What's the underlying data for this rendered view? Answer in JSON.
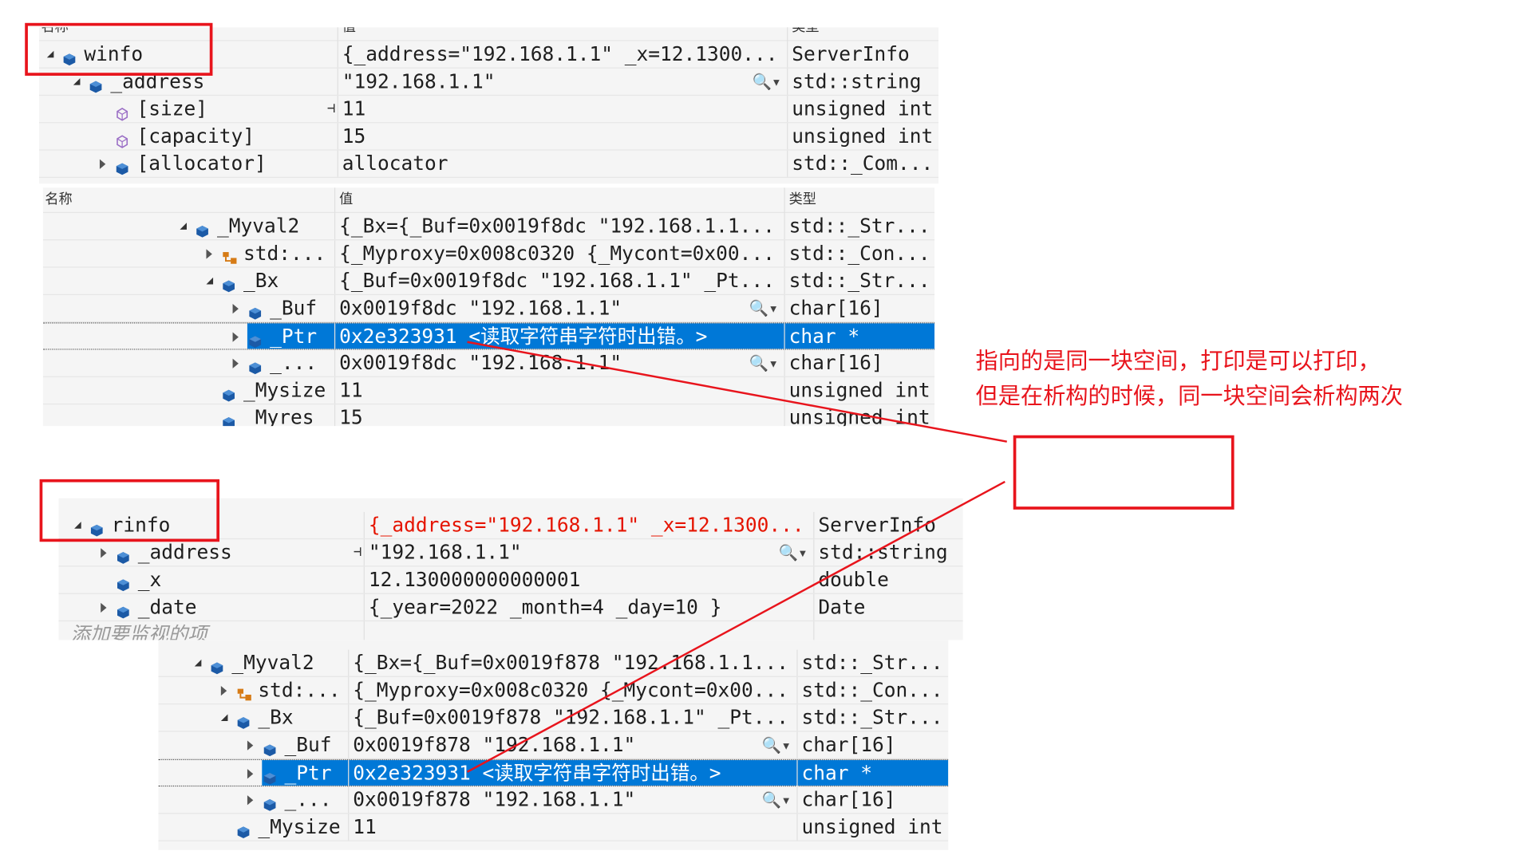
{
  "headers": {
    "name": "名称",
    "value": "值",
    "type": "类型"
  },
  "colors": {
    "annotation": "#e8141c",
    "selection": "#0078d7",
    "error_value": "#e51400"
  },
  "panels": [
    {
      "id": "winfo-watch",
      "show_header_labels": false,
      "rows": [
        {
          "depth": 0,
          "expander": "expanded",
          "icon": "field-icon",
          "name": "winfo",
          "value": "{_address=\"192.168.1.1\" _x=12.1300...",
          "type": "ServerInfo"
        },
        {
          "depth": 1,
          "expander": "expanded",
          "icon": "field-icon",
          "name": "_address",
          "value": "\"192.168.1.1\"",
          "type": "std::string",
          "magnifier": true
        },
        {
          "depth": 2,
          "expander": "none",
          "icon": "property-icon",
          "name": "[size]",
          "value": "11",
          "type": "unsigned int",
          "pin": true
        },
        {
          "depth": 2,
          "expander": "none",
          "icon": "property-icon",
          "name": "[capacity]",
          "value": "15",
          "type": "unsigned int"
        },
        {
          "depth": 2,
          "expander": "collapsed",
          "icon": "field-icon",
          "name": "[allocator]",
          "value": "allocator",
          "type": "std::_Com..."
        }
      ]
    },
    {
      "id": "winfo-myval2",
      "show_header_labels": true,
      "rows": [
        {
          "depth": 0,
          "expander": "expanded",
          "icon": "field-icon",
          "name": "_Myval2",
          "value": "{_Bx={_Buf=0x0019f8dc \"192.168.1.1...",
          "type": "std::_Str..."
        },
        {
          "depth": 1,
          "expander": "collapsed",
          "icon": "base-class-icon",
          "name": "std:...",
          "value": "{_Myproxy=0x008c0320 {_Mycont=0x00...",
          "type": "std::_Con..."
        },
        {
          "depth": 1,
          "expander": "expanded",
          "icon": "field-icon",
          "name": "_Bx",
          "value": "{_Buf=0x0019f8dc \"192.168.1.1\" _Pt...",
          "type": "std::_Str..."
        },
        {
          "depth": 2,
          "expander": "collapsed",
          "icon": "field-icon",
          "name": "_Buf",
          "value": "0x0019f8dc \"192.168.1.1\"",
          "type": "char[16]",
          "magnifier": true
        },
        {
          "depth": 2,
          "expander": "collapsed",
          "icon": "field-icon",
          "name": "_Ptr",
          "value": "0x2e323931 <读取字符串字符时出错。>",
          "type": "char *",
          "selected": true
        },
        {
          "depth": 2,
          "expander": "collapsed",
          "icon": "field-icon",
          "name": "_...",
          "value": "0x0019f8dc \"192.168.1.1\"",
          "type": "char[16]",
          "magnifier": true
        },
        {
          "depth": 1,
          "expander": "none",
          "icon": "field-icon",
          "name": "_Mysize",
          "value": "11",
          "type": "unsigned int"
        },
        {
          "depth": 1,
          "expander": "none",
          "icon": "field-icon",
          "name": "_Myres",
          "value": "15",
          "type": "unsigned int"
        }
      ]
    },
    {
      "id": "rinfo-watch",
      "show_header_labels": false,
      "rows": [
        {
          "depth": 0,
          "expander": "expanded",
          "icon": "field-icon",
          "name": "rinfo",
          "value": "{_address=\"192.168.1.1\" _x=12.1300...",
          "type": "ServerInfo",
          "value_changed": true
        },
        {
          "depth": 1,
          "expander": "collapsed",
          "icon": "field-icon",
          "name": "_address",
          "value": "\"192.168.1.1\"",
          "type": "std::string",
          "magnifier": true,
          "pin": true
        },
        {
          "depth": 1,
          "expander": "none",
          "icon": "field-icon",
          "name": "_x",
          "value": "12.130000000000001",
          "type": "double"
        },
        {
          "depth": 1,
          "expander": "collapsed",
          "icon": "field-icon",
          "name": "_date",
          "value": "{_year=2022 _month=4 _day=10 }",
          "type": "Date"
        }
      ],
      "add_watch_placeholder": "添加要监视的项"
    },
    {
      "id": "rinfo-myval2",
      "show_header_labels": false,
      "rows": [
        {
          "depth": 0,
          "expander": "expanded",
          "icon": "field-icon",
          "name": "_Myval2",
          "value": "{_Bx={_Buf=0x0019f878 \"192.168.1.1...",
          "type": "std::_Str..."
        },
        {
          "depth": 1,
          "expander": "collapsed",
          "icon": "base-class-icon",
          "name": "std:...",
          "value": "{_Myproxy=0x008c0320 {_Mycont=0x00...",
          "type": "std::_Con..."
        },
        {
          "depth": 1,
          "expander": "expanded",
          "icon": "field-icon",
          "name": "_Bx",
          "value": "{_Buf=0x0019f878 \"192.168.1.1\" _Pt...",
          "type": "std::_Str..."
        },
        {
          "depth": 2,
          "expander": "collapsed",
          "icon": "field-icon",
          "name": "_Buf",
          "value": "0x0019f878 \"192.168.1.1\"",
          "type": "char[16]",
          "magnifier": true
        },
        {
          "depth": 2,
          "expander": "collapsed",
          "icon": "field-icon",
          "name": "_Ptr",
          "value": "0x2e323931 <读取字符串字符时出错。>",
          "type": "char *",
          "selected": true
        },
        {
          "depth": 2,
          "expander": "collapsed",
          "icon": "field-icon",
          "name": "_...",
          "value": "0x0019f878 \"192.168.1.1\"",
          "type": "char[16]",
          "magnifier": true
        },
        {
          "depth": 1,
          "expander": "none",
          "icon": "field-icon",
          "name": "_Mysize",
          "value": "11",
          "type": "unsigned int"
        }
      ]
    }
  ],
  "annotation": {
    "line1": "指向的是同一块空间，打印是可以打印，",
    "line2": "但是在析构的时候，同一块空间会析构两次"
  }
}
